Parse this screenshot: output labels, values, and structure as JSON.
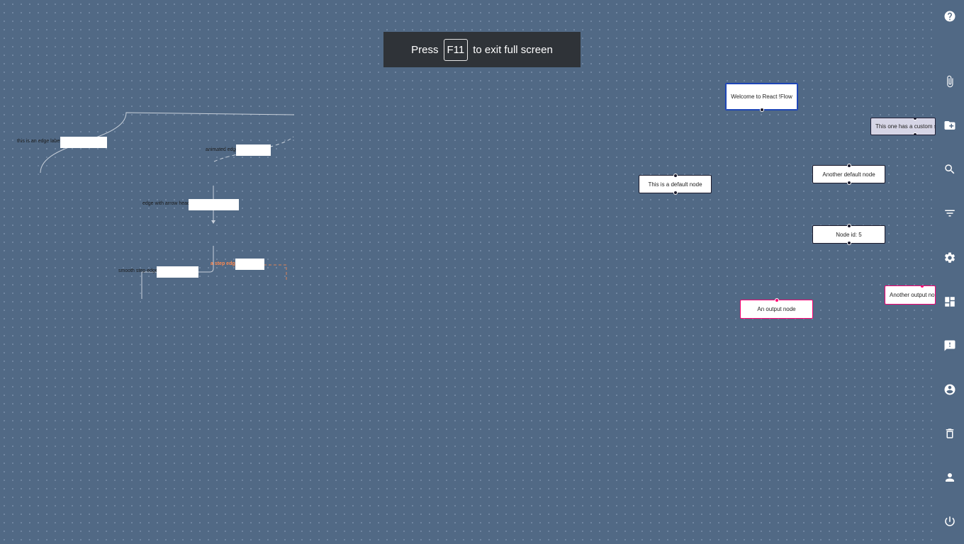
{
  "fullscreen_banner": {
    "prefix": "Press",
    "key": "F11",
    "suffix": "to exit full screen"
  },
  "edge_labels": {
    "edge_label": "this is an edge label",
    "animated": "animated edge",
    "arrow_head": "edge with arrow head",
    "smooth_step": "smooth step edge",
    "step": "a step edge"
  },
  "nodes": {
    "welcome": "Welcome to React !Flow",
    "custom": "This one has a custom style",
    "default": "This is a default node",
    "another_default": "Another default node",
    "node5": "Node id: 5",
    "output": "An output node",
    "another_output": "Another output node"
  },
  "sidebar": {
    "icons": [
      "help-icon",
      "attach-icon",
      "folder-add-icon",
      "search-icon",
      "filter-icon",
      "settings-icon",
      "dashboard-icon",
      "feedback-icon",
      "account-circle-icon",
      "delete-icon",
      "person-icon",
      "power-icon"
    ]
  },
  "colors": {
    "canvas_bg": "#516985",
    "input_border": "#1e46b6",
    "output_border": "#ff0072",
    "step_label": "#ff8a50"
  }
}
